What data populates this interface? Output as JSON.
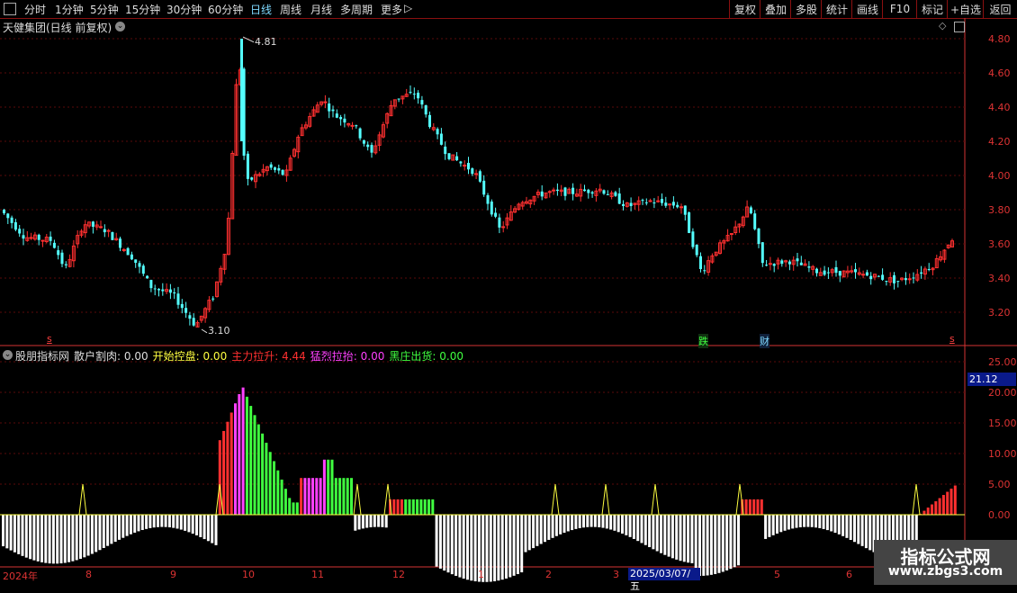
{
  "toolbar": {
    "menu": [
      "分时",
      "1分钟",
      "5分钟",
      "15分钟",
      "30分钟",
      "60分钟",
      "日线",
      "周线",
      "月线",
      "多周期",
      "更多"
    ],
    "active_index": 6,
    "more_arrow": "▷",
    "right_buttons": [
      "复权",
      "叠加",
      "多股",
      "统计",
      "画线",
      "F10",
      "标记",
      "+自选",
      "返回"
    ]
  },
  "main_panel": {
    "title": "天健集团(日线 前复权)",
    "price_axis": [
      "4.80",
      "4.60",
      "4.40",
      "4.20",
      "4.00",
      "3.80",
      "3.60",
      "3.40",
      "3.20"
    ],
    "high_label": "4.81",
    "low_label": "3.10",
    "markers": {
      "s1": "s",
      "s2": "s",
      "die": "跌",
      "cai": "财"
    }
  },
  "indicator_panel": {
    "title": "股朋指标网",
    "items": [
      {
        "label": "散户割肉:",
        "value": "0.00",
        "color": "#dddddd"
      },
      {
        "label": "开始控盘:",
        "value": "0.00",
        "color": "#ffff40"
      },
      {
        "label": "主力拉升:",
        "value": "4.44",
        "color": "#ff3030"
      },
      {
        "label": "猛烈拉抬:",
        "value": "0.00",
        "color": "#ff40ff"
      },
      {
        "label": "黑庄出货:",
        "value": "0.00",
        "color": "#40ff40"
      }
    ],
    "axis": [
      "25.00",
      "20.00",
      "15.00",
      "10.00",
      "5.00",
      "0.00"
    ],
    "cursor_value": "21.12"
  },
  "date_axis": {
    "labels": [
      "2024年",
      "8",
      "9",
      "10",
      "11",
      "12",
      "1",
      "2",
      "3",
      "4",
      "5",
      "6"
    ],
    "highlight": "2025/03/07/五"
  },
  "watermark": {
    "title": "指标公式网",
    "url": "www.zbgs3.com"
  },
  "colors": {
    "up": "#ff3030",
    "down": "#54ffff",
    "axis": "#d33333",
    "grid": "#5a0a0a"
  }
}
